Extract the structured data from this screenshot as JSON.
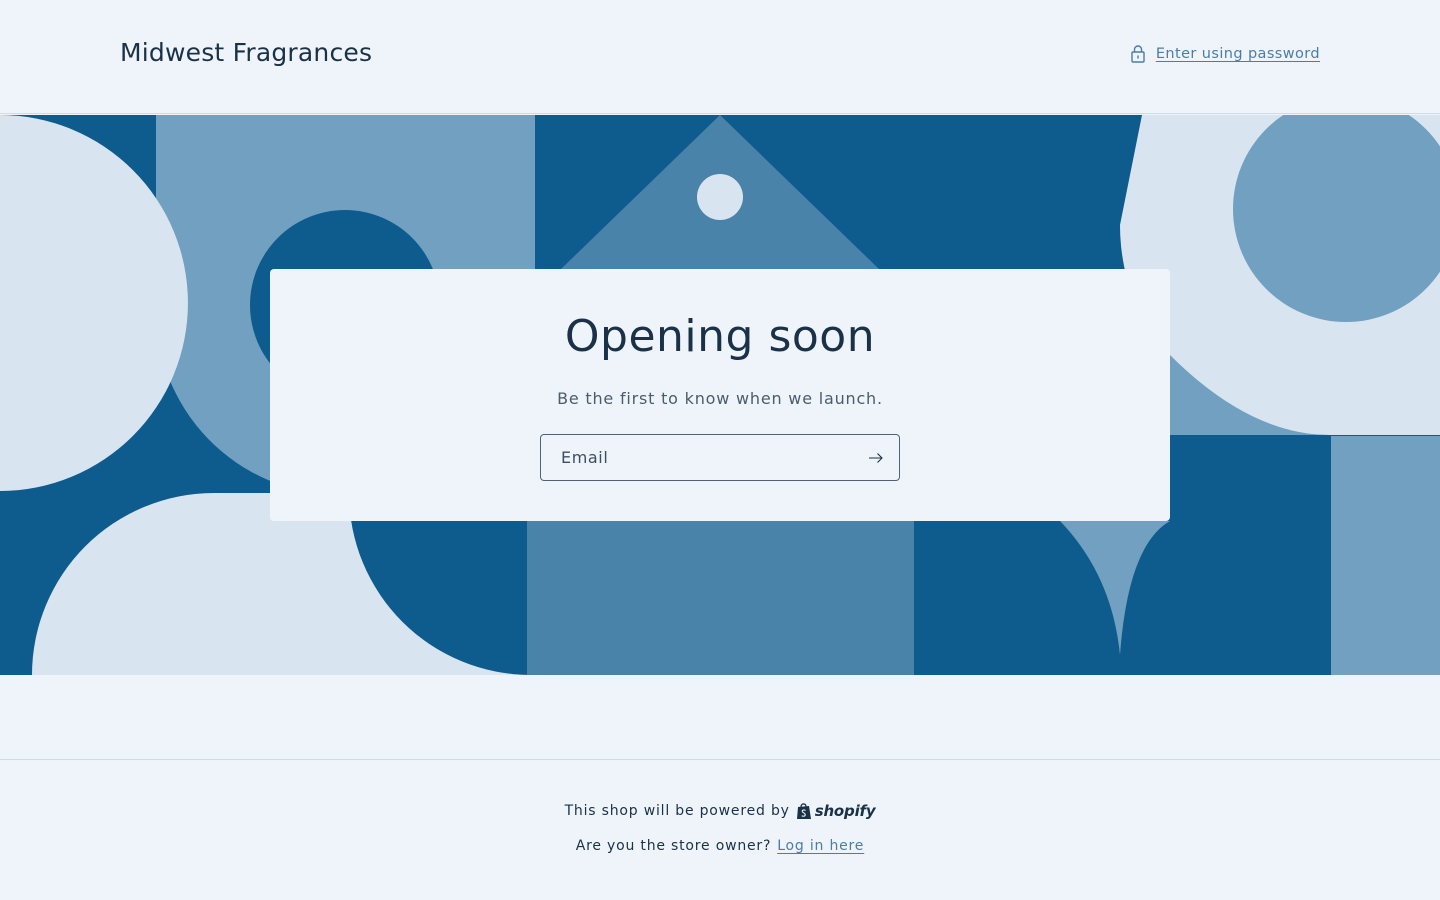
{
  "header": {
    "store_name": "Midwest Fragrances",
    "password_link_label": "Enter using password",
    "lock_icon": "lock-icon"
  },
  "main": {
    "title": "Opening soon",
    "subtitle": "Be the first to know when we launch.",
    "email_placeholder": "Email",
    "submit_icon": "arrow-right-icon"
  },
  "footer": {
    "powered_by_text": "This shop will be powered by",
    "shopify_logo_text": "shopify",
    "owner_prompt": "Are you the store owner?",
    "login_link_label": "Log in here"
  },
  "colors": {
    "background": "#eef4f9",
    "text": "#1b3147",
    "link": "#4a7ea8",
    "banner_dark": "#0e5b8e",
    "banner_mid": "#4a83aa",
    "banner_light": "#71a0c0",
    "banner_pale": "#d8e5f0"
  }
}
